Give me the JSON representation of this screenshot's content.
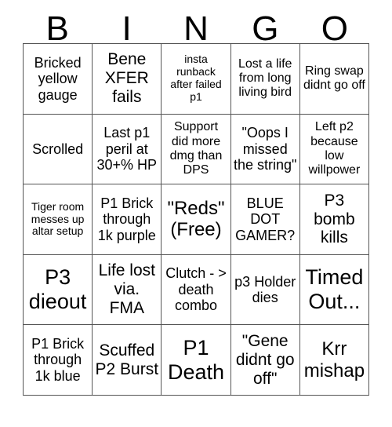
{
  "header": {
    "letters": [
      "B",
      "I",
      "N",
      "G",
      "O"
    ]
  },
  "grid": {
    "columns": 5,
    "rows": 5,
    "cells": [
      {
        "text": "Bricked yellow gauge",
        "size": "md"
      },
      {
        "text": "Bene XFER fails",
        "size": "lg"
      },
      {
        "text": "insta runback after failed p1",
        "size": "xs"
      },
      {
        "text": "Lost a life from long living bird",
        "size": "sm"
      },
      {
        "text": "Ring swap didnt go off",
        "size": "sm"
      },
      {
        "text": "Scrolled",
        "size": "md"
      },
      {
        "text": "Last p1 peril at 30+% HP",
        "size": "md"
      },
      {
        "text": "Support did more dmg than DPS",
        "size": "sm"
      },
      {
        "text": "\"Oops I missed the string\"",
        "size": "md"
      },
      {
        "text": "Left p2 because low willpower",
        "size": "sm"
      },
      {
        "text": "Tiger room messes up altar setup",
        "size": "xs"
      },
      {
        "text": "P1 Brick through 1k purple",
        "size": "md"
      },
      {
        "text": "\"Reds\" (Free)",
        "size": "xl"
      },
      {
        "text": "BLUE DOT GAMER?",
        "size": "md"
      },
      {
        "text": "P3 bomb kills",
        "size": "lg"
      },
      {
        "text": "P3 dieout",
        "size": "xxl"
      },
      {
        "text": "Life lost via. FMA",
        "size": "lg"
      },
      {
        "text": "Clutch - > death combo",
        "size": "md"
      },
      {
        "text": "p3 Holder dies",
        "size": "md"
      },
      {
        "text": "Timed Out...",
        "size": "xxl"
      },
      {
        "text": "P1 Brick through 1k blue",
        "size": "md"
      },
      {
        "text": "Scuffed P2 Burst",
        "size": "lg"
      },
      {
        "text": "P1 Death",
        "size": "xxl"
      },
      {
        "text": "\"Gene didnt go off\"",
        "size": "lg"
      },
      {
        "text": "Krr mishap",
        "size": "xl"
      }
    ]
  },
  "colors": {
    "background": "#ffffff",
    "text": "#000000",
    "grid_line": "#555555"
  }
}
